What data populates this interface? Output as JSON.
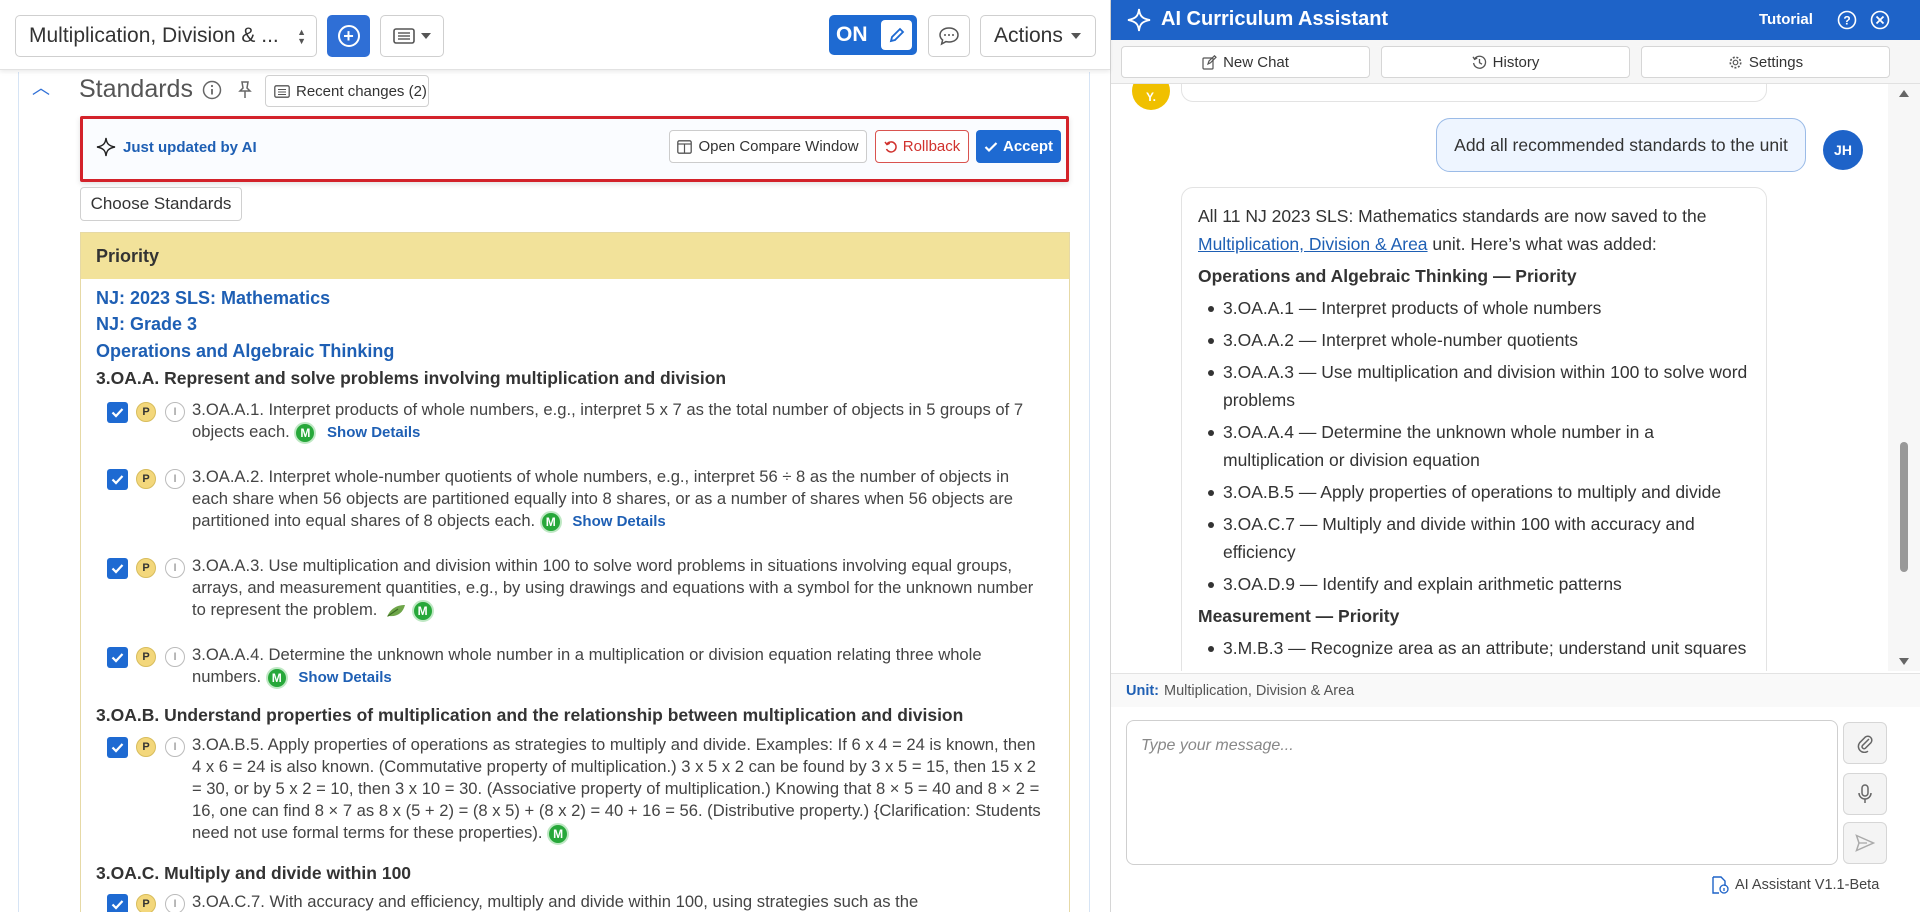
{
  "topbar": {
    "unit_title": "Multiplication, Division & ...",
    "on_label": "ON",
    "actions_label": "Actions"
  },
  "standards": {
    "title": "Standards",
    "recent_changes": "Recent changes (2)",
    "ai_banner_label": "Just updated by AI",
    "compare_label": "Open Compare Window",
    "rollback_label": "Rollback",
    "accept_label": "Accept",
    "choose_label": "Choose Standards",
    "priority_label": "Priority",
    "crumbs": [
      "NJ: 2023 SLS: Mathematics",
      "NJ: Grade 3",
      "Operations and Algebraic Thinking"
    ],
    "clusters": [
      "3.OA.A. Represent and solve problems involving multiplication and division",
      "3.OA.B. Understand properties of multiplication and the relationship between multiplication and division",
      "3.OA.C. Multiply and divide within 100"
    ],
    "items": [
      {
        "p": "P",
        "i": "I",
        "text": "3.OA.A.1. Interpret products of whole numbers, e.g., interpret 5 x 7 as the total number of objects in 5 groups of 7 objects each.",
        "m": "M",
        "details": "Show Details"
      },
      {
        "p": "P",
        "i": "I",
        "text": "3.OA.A.2. Interpret whole-number quotients of whole numbers, e.g., interpret 56 ÷ 8 as the number of objects in each share when 56 objects are partitioned equally into 8 shares, or as a number of shares when 56 objects are partitioned into equal shares of 8 objects each.",
        "m": "M",
        "details": "Show Details"
      },
      {
        "p": "P",
        "i": "I",
        "text": "3.OA.A.3. Use multiplication and division within 100 to solve word problems in situations involving equal groups, arrays, and measurement quantities, e.g., by using drawings and equations with a symbol for the unknown number to represent the problem.",
        "m": "M"
      },
      {
        "p": "P",
        "i": "I",
        "text": "3.OA.A.4. Determine the unknown whole number in a multiplication or division equation relating three whole numbers.",
        "m": "M",
        "details": "Show Details"
      },
      {
        "p": "P",
        "i": "I",
        "text": "3.OA.B.5. Apply properties of operations as strategies to multiply and divide. Examples: If 6 x 4 = 24 is known, then 4 x 6 = 24 is also known. (Commutative property of multiplication.) 3 x 5 x 2 can be found by 3 x 5 = 15, then 15 x 2 = 30, or by 5 x 2 = 10, then 3 x 10 = 30. (Associative property of multiplication.) Knowing that 8 × 5 = 40 and 8 × 2 = 16, one can find 8 × 7 as 8 x (5 + 2) = (8 x 5) + (8 x 2) = 40 + 16 = 56. (Distributive property.) {Clarification: Students need not use formal terms for these properties).",
        "m": "M"
      },
      {
        "p": "P",
        "i": "I",
        "text": "3.OA.C.7. With accuracy and efficiency, multiply and divide within 100, using strategies such as the"
      }
    ]
  },
  "assistant": {
    "title": "AI Curriculum Assistant",
    "tutorial": "Tutorial",
    "tabs": [
      "New Chat",
      "History",
      "Settings"
    ],
    "prev_avatar": "Y.",
    "user_message": "Add all recommended standards to the unit",
    "user_initials": "JH",
    "reply_intro_1": "All 11 NJ 2023 SLS: Mathematics standards are now saved to the ",
    "reply_link": "Multiplication, Division & Area",
    "reply_intro_2": " unit. Here’s what was added:",
    "section_1": "Operations and Algebraic Thinking — Priority",
    "list_1": [
      "3.OA.A.1 — Interpret products of whole numbers",
      "3.OA.A.2 — Interpret whole-number quotients",
      "3.OA.A.3 — Use multiplication and division within 100 to solve word problems",
      "3.OA.A.4 — Determine the unknown whole number in a multiplication or division equation",
      "3.OA.B.5 — Apply properties of operations to multiply and divide",
      "3.OA.C.7 — Multiply and divide within 100 with accuracy and efficiency",
      "3.OA.D.9 — Identify and explain arithmetic patterns"
    ],
    "section_2": "Measurement — Priority",
    "list_2": [
      "3.M.B.3 — Recognize area as an attribute; understand unit squares"
    ],
    "unit_label": "Unit:",
    "unit_value": "Multiplication, Division & Area",
    "input_placeholder": "Type your message...",
    "version": "AI Assistant V1.1-Beta"
  },
  "colors": {
    "primary": "#1e6ad2",
    "header": "#1e63c8",
    "priority": "#f2e29a",
    "rollback": "#d0312d",
    "banner_border": "#d3222a",
    "mastery": "#27a83a"
  }
}
